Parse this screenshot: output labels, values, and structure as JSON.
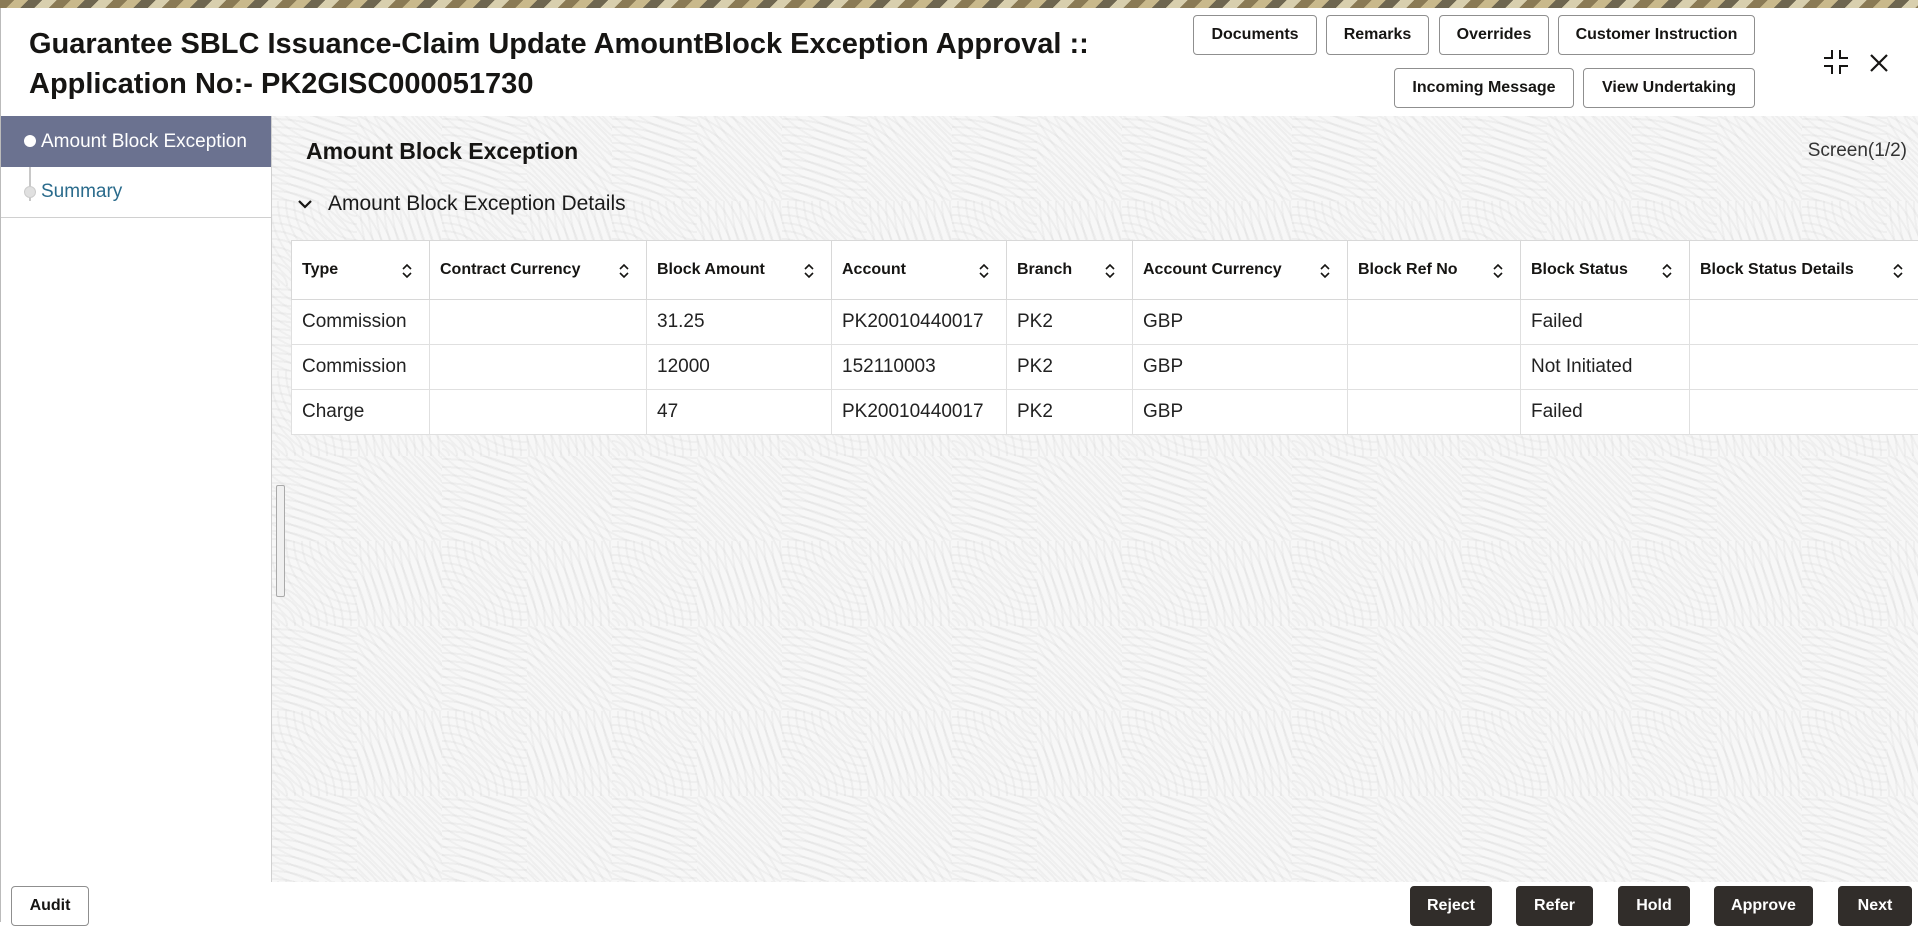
{
  "header": {
    "title_line1": "Guarantee SBLC Issuance-Claim Update AmountBlock Exception Approval ::",
    "title_line2": "Application No:- PK2GISC000051730",
    "buttons": {
      "documents": "Documents",
      "remarks": "Remarks",
      "overrides": "Overrides",
      "customer_instruction": "Customer Instruction",
      "incoming_message": "Incoming Message",
      "view_undertaking": "View Undertaking"
    },
    "icons": [
      "collapse-icon",
      "close-icon"
    ]
  },
  "sidebar": {
    "items": [
      {
        "label": "Amount Block Exception",
        "active": true
      },
      {
        "label": "Summary",
        "active": false
      }
    ]
  },
  "main": {
    "section_title": "Amount Block Exception",
    "screen_indicator": "Screen(1/2)",
    "subsection_title": "Amount Block Exception Details",
    "table": {
      "columns": [
        "Type",
        "Contract Currency",
        "Block Amount",
        "Account",
        "Branch",
        "Account Currency",
        "Block Ref No",
        "Block Status",
        "Block Status Details"
      ],
      "rows": [
        [
          "Commission",
          "",
          "31.25",
          "PK20010440017",
          "PK2",
          "GBP",
          "",
          "Failed",
          ""
        ],
        [
          "Commission",
          "",
          "12000",
          "152110003",
          "PK2",
          "GBP",
          "",
          "Not Initiated",
          ""
        ],
        [
          "Charge",
          "",
          "47",
          "PK20010440017",
          "PK2",
          "GBP",
          "",
          "Failed",
          ""
        ]
      ]
    }
  },
  "footer": {
    "audit": "Audit",
    "reject": "Reject",
    "refer": "Refer",
    "hold": "Hold",
    "approve": "Approve",
    "next": "Next"
  },
  "colors": {
    "sidebar_active_bg": "#6b7290",
    "link_text": "#2a6b8c",
    "dark_button": "#312d2a"
  }
}
